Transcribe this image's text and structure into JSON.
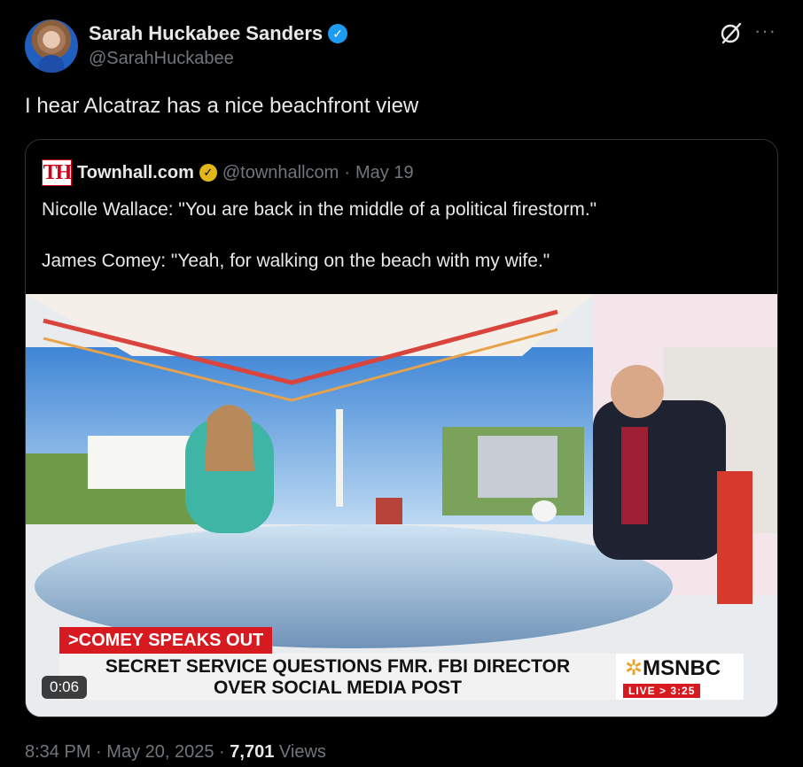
{
  "author": {
    "name": "Sarah Huckabee Sanders",
    "handle": "@SarahHuckabee",
    "verified_icon": "check"
  },
  "tweet": {
    "text": "I hear Alcatraz has a nice beachfront view"
  },
  "quote": {
    "logo_text": "TH",
    "name": "Townhall.com",
    "verified_icon": "check",
    "handle": "@townhallcom",
    "separator": "·",
    "date": "May 19",
    "line1": "Nicolle Wallace: \"You are back in the middle of a political firestorm.\"",
    "line2": "James Comey: \"Yeah, for walking on the beach with my wife.\""
  },
  "video": {
    "duration": "0:06",
    "tag": ">COMEY SPEAKS OUT",
    "headline_line1": "SECRET SERVICE QUESTIONS FMR. FBI DIRECTOR",
    "headline_line2": "OVER SOCIAL MEDIA POST",
    "network": "MSNBC",
    "live_label": "LIVE > 3:25"
  },
  "meta": {
    "time": "8:34 PM",
    "sep1": "·",
    "date": "May 20, 2025",
    "sep2": "·",
    "views_count": "7,701",
    "views_label": "Views"
  },
  "colors": {
    "background": "#000000",
    "text": "#e7e9ea",
    "muted": "#71767b",
    "verified_blue": "#1d9bf0",
    "verified_gold": "#e2b719",
    "msnbc_red": "#d71920"
  }
}
